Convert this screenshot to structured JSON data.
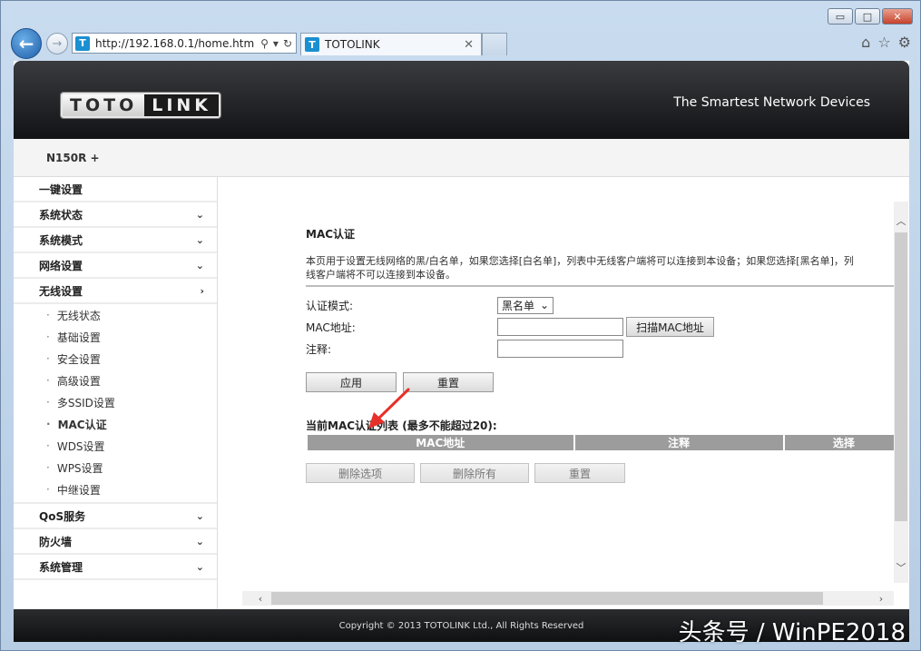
{
  "browser": {
    "url": "http://192.168.0.1/home.htm",
    "tab_title": "TOTOLINK",
    "favicon_letter": "T",
    "window_controls": {
      "minimize": "▭",
      "maximize": "□",
      "close": "✕"
    }
  },
  "header": {
    "logo_left": "TOTO",
    "logo_right": "LINK",
    "tagline": "The Smartest Network Devices",
    "model": "N150R +"
  },
  "sidebar": {
    "items": [
      {
        "label": "一键设置",
        "chevron": ""
      },
      {
        "label": "系统状态",
        "chevron": "⌄"
      },
      {
        "label": "系统模式",
        "chevron": "⌄"
      },
      {
        "label": "网络设置",
        "chevron": "⌄"
      },
      {
        "label": "无线设置",
        "chevron": "›"
      }
    ],
    "sub_items": [
      {
        "label": "无线状态"
      },
      {
        "label": "基础设置"
      },
      {
        "label": "安全设置"
      },
      {
        "label": "高级设置"
      },
      {
        "label": "多SSID设置"
      },
      {
        "label": "MAC认证"
      },
      {
        "label": "WDS设置"
      },
      {
        "label": "WPS设置"
      },
      {
        "label": "中继设置"
      }
    ],
    "items_after": [
      {
        "label": "QoS服务",
        "chevron": "⌄"
      },
      {
        "label": "防火墙",
        "chevron": "⌄"
      },
      {
        "label": "系统管理",
        "chevron": "⌄"
      }
    ]
  },
  "main": {
    "title": "MAC认证",
    "desc_line1": "本页用于设置无线网络的黑/白名单，如果您选择[白名单]，列表中无线客户端将可以连接到本设备；如果您选择[黑名单]，列",
    "desc_line2": "线客户端将不可以连接到本设备。",
    "form": {
      "mode_label": "认证模式:",
      "mode_value": "黑名单",
      "mac_label": "MAC地址:",
      "mac_value": "",
      "scan_button": "扫描MAC地址",
      "note_label": "注释:",
      "note_value": ""
    },
    "apply_button": "应用",
    "reset_button": "重置",
    "list": {
      "title": "当前MAC认证列表 (最多不能超过20):",
      "headers": [
        "MAC地址",
        "注释",
        "选择"
      ]
    },
    "delete_selected_button": "删除选项",
    "delete_all_button": "删除所有",
    "list_reset_button": "重置"
  },
  "footer": {
    "copyright": "Copyright © 2013 TOTOLINK Ltd.,   All Rights Reserved"
  },
  "watermark": "头条号 / WinPE2018",
  "colors": {
    "arrow": "#e8302a",
    "banner": "#1a1b1e",
    "table_header": "#9c9c9c"
  }
}
